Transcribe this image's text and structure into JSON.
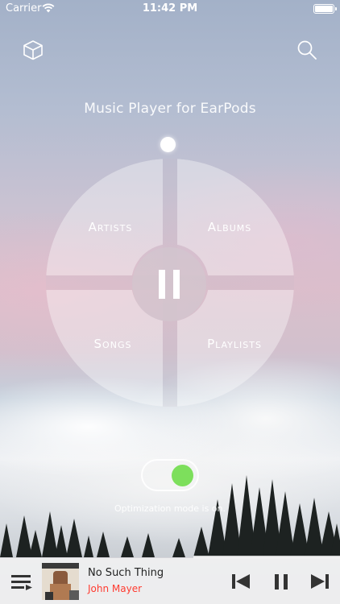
{
  "status_bar": {
    "carrier": "Carrier",
    "time": "11:42 PM"
  },
  "header": {
    "title": "Music Player for EarPods"
  },
  "wheel": {
    "quadrants": [
      {
        "label": "Artists"
      },
      {
        "label": "Albums"
      },
      {
        "label": "Songs"
      },
      {
        "label": "Playlists"
      }
    ]
  },
  "optimization": {
    "enabled": true,
    "status_text": "Optimization mode is on."
  },
  "now_playing": {
    "title": "No Such Thing",
    "artist": "John Mayer"
  },
  "colors": {
    "toggle_on": "#7ddf5c",
    "artist_text": "#ff3b30"
  },
  "icons": [
    "cube-icon",
    "search-icon",
    "wifi-icon",
    "battery-icon",
    "queue-icon",
    "previous-icon",
    "pause-icon",
    "next-icon"
  ]
}
